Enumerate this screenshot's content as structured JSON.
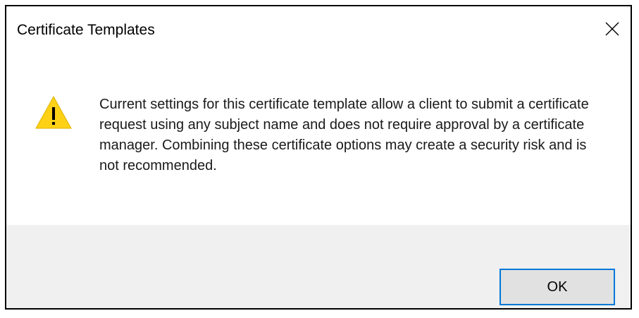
{
  "dialog": {
    "title": "Certificate Templates",
    "close_icon": "close-icon",
    "warning_icon": "warning-icon",
    "warning_color": "#fcd116",
    "message": "Current settings for this certificate template allow a client to submit a certificate request using any subject name and does not require approval by a certificate manager. Combining these certificate options may create a security risk and is not recommended.",
    "ok_label": "OK",
    "accent_color": "#0078d7",
    "footer_color": "#f0f0f0"
  }
}
